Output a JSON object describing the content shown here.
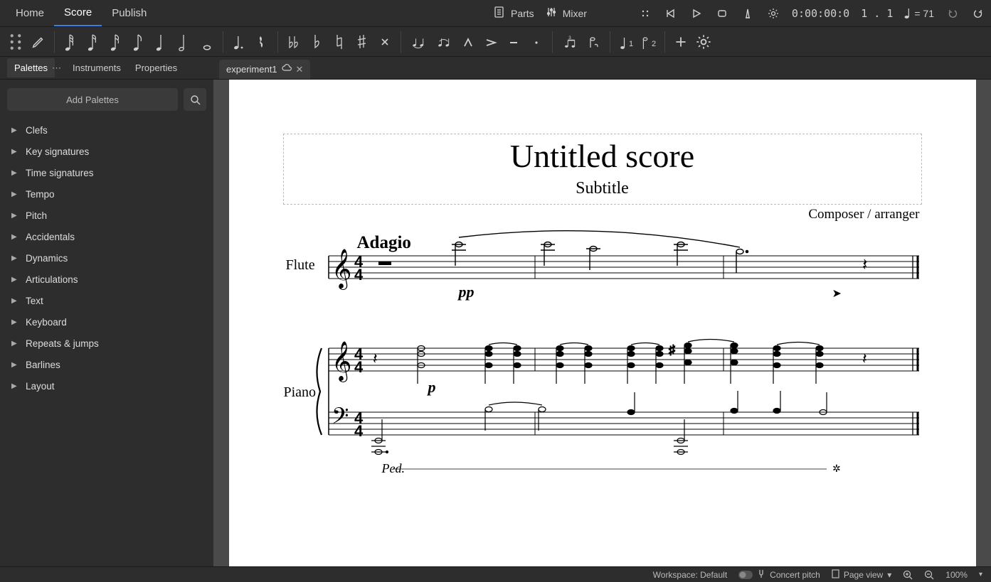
{
  "menubar": {
    "home": "Home",
    "score": "Score",
    "publish": "Publish",
    "parts": "Parts",
    "mixer": "Mixer",
    "time": "0:00:00:0",
    "beat": "1 . 1",
    "tempo_eq": "= 71"
  },
  "panel": {
    "palettes": "Palettes",
    "instruments": "Instruments",
    "properties": "Properties",
    "add_palettes": "Add Palettes"
  },
  "doc": {
    "name": "experiment1"
  },
  "palettes": [
    "Clefs",
    "Key signatures",
    "Time signatures",
    "Tempo",
    "Pitch",
    "Accidentals",
    "Dynamics",
    "Articulations",
    "Text",
    "Keyboard",
    "Repeats & jumps",
    "Barlines",
    "Layout"
  ],
  "score": {
    "title": "Untitled score",
    "subtitle": "Subtitle",
    "composer": "Composer / arranger",
    "tempo_mark": "Adagio",
    "instrument1": "Flute",
    "instrument2": "Piano",
    "dynamic_pp": "pp",
    "dynamic_p": "p",
    "pedal": "Ped."
  },
  "status": {
    "workspace": "Workspace: Default",
    "concert": "Concert pitch",
    "pageview": "Page view",
    "zoom": "100%"
  }
}
